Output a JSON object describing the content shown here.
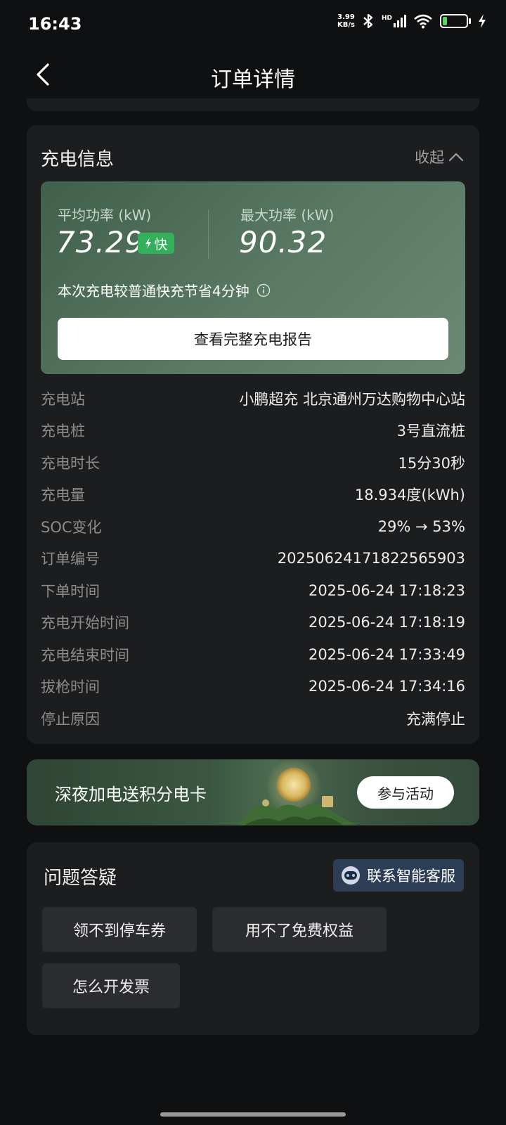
{
  "status_bar": {
    "time": "16:43",
    "net_speed_value": "3.99",
    "net_speed_unit": "KB/s",
    "signal_label": "HD",
    "battery": "27",
    "battery_percent": 27
  },
  "header": {
    "title": "订单详情"
  },
  "charge_info": {
    "title": "充电信息",
    "collapse_label": "收起",
    "avg_power_label": "平均功率 (kW)",
    "avg_power_value": "73.29",
    "fast_badge": "快",
    "max_power_label": "最大功率 (kW)",
    "max_power_value": "90.32",
    "saving_text": "本次充电较普通快充节省4分钟",
    "report_button": "查看完整充电报告",
    "rows": [
      {
        "label": "充电站",
        "value": "小鹏超充 北京通州万达购物中心站"
      },
      {
        "label": "充电桩",
        "value": "3号直流桩"
      },
      {
        "label": "充电时长",
        "value": "15分30秒"
      },
      {
        "label": "充电量",
        "value": "18.934度(kWh)"
      },
      {
        "label": "SOC变化",
        "value": "29% → 53%"
      },
      {
        "label": "订单编号",
        "value": "20250624171822565903"
      },
      {
        "label": "下单时间",
        "value": "2025-06-24 17:18:23"
      },
      {
        "label": "充电开始时间",
        "value": "2025-06-24 17:18:19"
      },
      {
        "label": "充电结束时间",
        "value": "2025-06-24 17:33:49"
      },
      {
        "label": "拔枪时间",
        "value": "2025-06-24 17:34:16"
      },
      {
        "label": "停止原因",
        "value": "充满停止"
      }
    ]
  },
  "promo": {
    "text": "深夜加电送积分电卡",
    "button": "参与活动"
  },
  "faq": {
    "title": "问题答疑",
    "service_button": "联系智能客服",
    "chips": [
      "领不到停车券",
      "用不了免费权益",
      "怎么开发票"
    ]
  },
  "colors": {
    "background": "#0f1011",
    "card": "#1c1d1f",
    "panel_green": "#5a7a65",
    "badge_green": "#35b05a",
    "service_blue": "#2d3d55"
  }
}
